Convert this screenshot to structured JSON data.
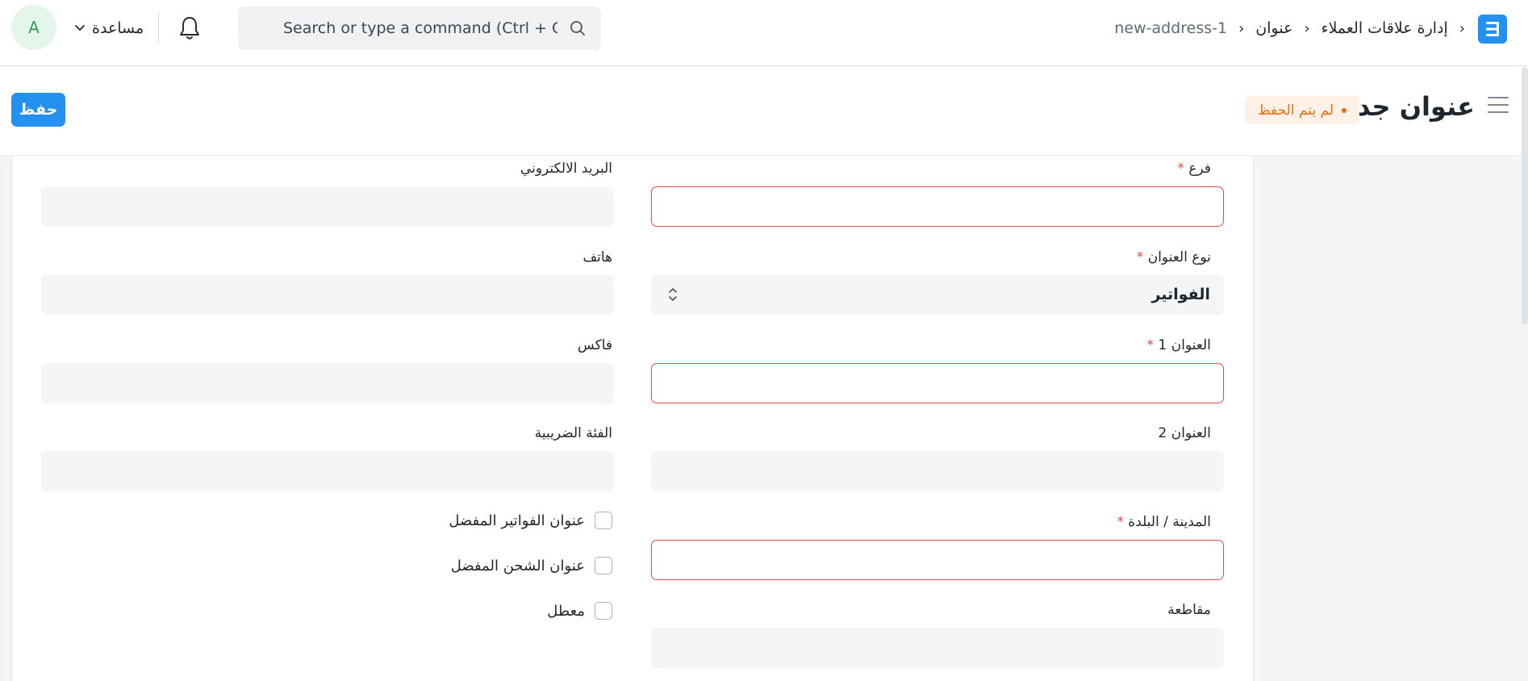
{
  "nav": {
    "breadcrumb": [
      "إدارة علاقات العملاء",
      "عنوان",
      "new-address-1"
    ],
    "search_placeholder": "Search or type a command (Ctrl + G)",
    "help_label": "مساعدة",
    "avatar_initial": "A"
  },
  "page": {
    "title": "عنوان جديد",
    "status": "لم يتم الحفظ",
    "save_label": "حفظ"
  },
  "form": {
    "right": {
      "branch_label": "فرع",
      "address_type_label": "نوع العنوان",
      "address_type_value": "الفواتير",
      "address1_label": "العنوان 1",
      "address2_label": "العنوان 2",
      "city_label": "المدينة / البلدة",
      "county_label": "مقاطعة"
    },
    "left": {
      "email_label": "البريد الالكتروني",
      "phone_label": "هاتف",
      "fax_label": "فاكس",
      "tax_category_label": "الفئة الضريبية",
      "preferred_billing_label": "عنوان الفواتير المفضل",
      "preferred_shipping_label": "عنوان الشحن المفضل",
      "disabled_label": "معطل"
    },
    "required_mark": "*"
  },
  "colors": {
    "accent": "#2490ef",
    "error": "#e24c4c",
    "status_warning": "#e86c13"
  }
}
